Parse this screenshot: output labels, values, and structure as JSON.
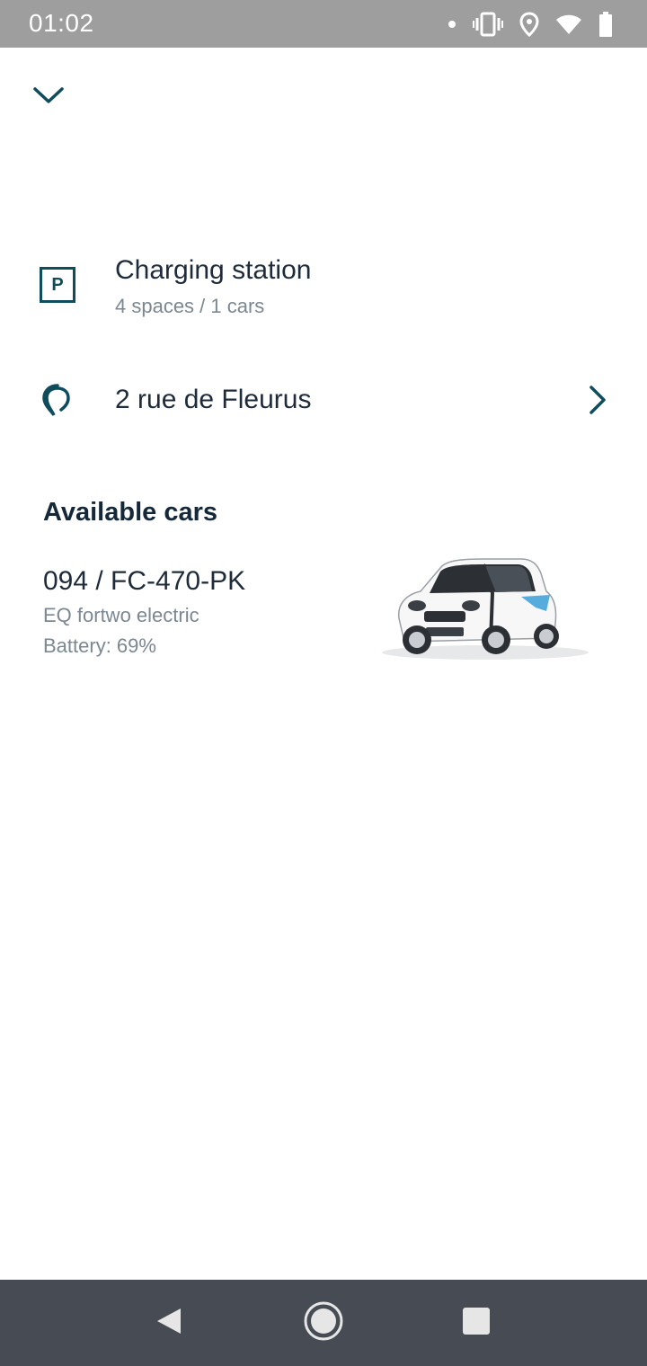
{
  "status_bar": {
    "time": "01:02"
  },
  "station": {
    "icon_letter": "P",
    "title": "Charging station",
    "subtitle": "4 spaces / 1 cars"
  },
  "address": {
    "text": "2 rue de Fleurus"
  },
  "available_cars": {
    "title": "Available cars",
    "cars": [
      {
        "plate": "094 / FC-470-PK",
        "model": "EQ fortwo electric",
        "battery": "Battery: 69%",
        "battery_level": 69
      }
    ]
  },
  "colors": {
    "accent": "#0f4c5c",
    "status_bar": "#9e9e9e",
    "nav_bar": "#474c54",
    "primary_text": "#1d2b3a",
    "secondary_text": "#7b8791"
  },
  "icons": {
    "collapse": "chevron-down-icon",
    "parking": "parking-icon",
    "location": "location-pin-icon",
    "navigate": "chevron-right-icon",
    "back": "back-icon",
    "home": "home-icon",
    "recents": "recents-icon"
  }
}
